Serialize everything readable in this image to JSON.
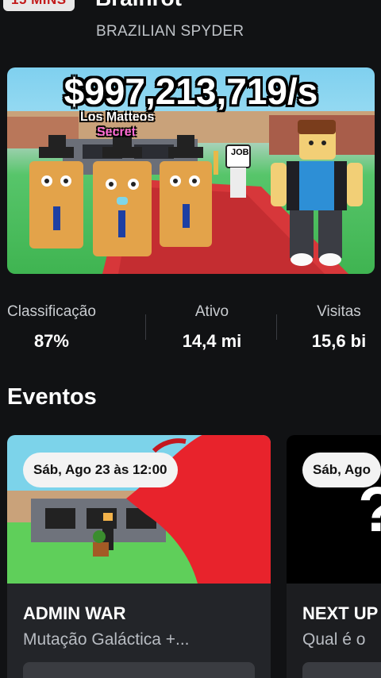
{
  "header": {
    "badge": "15 MINS",
    "title": "Brainrot",
    "creator": "BRAZILIAN SPYDER"
  },
  "hero": {
    "rate": "$997,213,719/s",
    "character_name": "Los Matteos",
    "rarity": "Secret",
    "sign_text": "JOB"
  },
  "stats": [
    {
      "label": "Classificação",
      "value": "87%"
    },
    {
      "label": "Ativo",
      "value": "14,4 mi"
    },
    {
      "label": "Visitas",
      "value": "15,6 bi"
    }
  ],
  "events": {
    "title": "Eventos",
    "cards": [
      {
        "date": "Sáb, Ago 23 às 12:00",
        "title": "ADMIN WAR",
        "subtitle": "Mutação Galáctica +..."
      },
      {
        "date": "Sáb, Ago",
        "title": "NEXT UP",
        "subtitle": "Qual é o"
      }
    ]
  },
  "colors": {
    "background": "#111214",
    "card": "#232529",
    "badge_text": "#c21a1a"
  }
}
